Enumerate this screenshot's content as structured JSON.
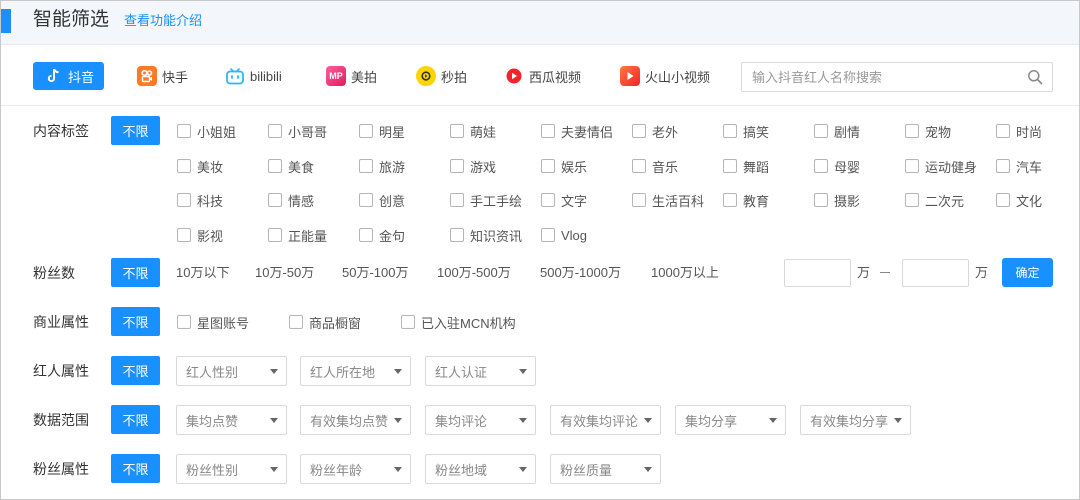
{
  "header": {
    "title": "智能筛选",
    "intro_link": "查看功能介绍"
  },
  "platforms": [
    {
      "label": "抖音",
      "icon": "douyin-icon",
      "color": "#1890ff"
    },
    {
      "label": "快手",
      "icon": "kuaishou-icon",
      "color": "#ff7a28"
    },
    {
      "label": "bilibili",
      "icon": "bilibili-icon",
      "color": "#2db7f5"
    },
    {
      "label": "美拍",
      "icon": "meipai-icon",
      "color": "#ff3f7f",
      "glyph": "MP"
    },
    {
      "label": "秒拍",
      "icon": "miaopai-icon",
      "color": "#ffd400"
    },
    {
      "label": "西瓜视频",
      "icon": "xigua-icon",
      "color": "#f5222d"
    },
    {
      "label": "火山小视频",
      "icon": "huoshan-icon",
      "color": "#f5502d"
    }
  ],
  "search": {
    "placeholder": "输入抖音红人名称搜索"
  },
  "common": {
    "nolimit": "不限"
  },
  "content_tags": {
    "label": "内容标签",
    "tags": [
      "小姐姐",
      "小哥哥",
      "明星",
      "萌娃",
      "夫妻情侣",
      "老外",
      "搞笑",
      "剧情",
      "宠物",
      "时尚",
      "美妆",
      "美食",
      "旅游",
      "游戏",
      "娱乐",
      "音乐",
      "舞蹈",
      "母婴",
      "运动健身",
      "汽车",
      "科技",
      "情感",
      "创意",
      "手工手绘",
      "文字",
      "生活百科",
      "教育",
      "摄影",
      "二次元",
      "文化",
      "影视",
      "正能量",
      "金句",
      "知识资讯",
      "Vlog"
    ]
  },
  "fans_count": {
    "label": "粉丝数",
    "options": [
      "10万以下",
      "10万-50万",
      "50万-100万",
      "100万-500万",
      "500万-1000万",
      "1000万以上"
    ],
    "unit": "万",
    "confirm": "确定"
  },
  "business": {
    "label": "商业属性",
    "options": [
      "星图账号",
      "商品橱窗",
      "已入驻MCN机构"
    ]
  },
  "influencer": {
    "label": "红人属性",
    "dropdowns": [
      "红人性别",
      "红人所在地",
      "红人认证"
    ]
  },
  "data_range": {
    "label": "数据范围",
    "dropdowns": [
      "集均点赞",
      "有效集均点赞",
      "集均评论",
      "有效集均评论",
      "集均分享",
      "有效集均分享"
    ]
  },
  "fans_attr": {
    "label": "粉丝属性",
    "dropdowns": [
      "粉丝性别",
      "粉丝年龄",
      "粉丝地域",
      "粉丝质量"
    ]
  }
}
